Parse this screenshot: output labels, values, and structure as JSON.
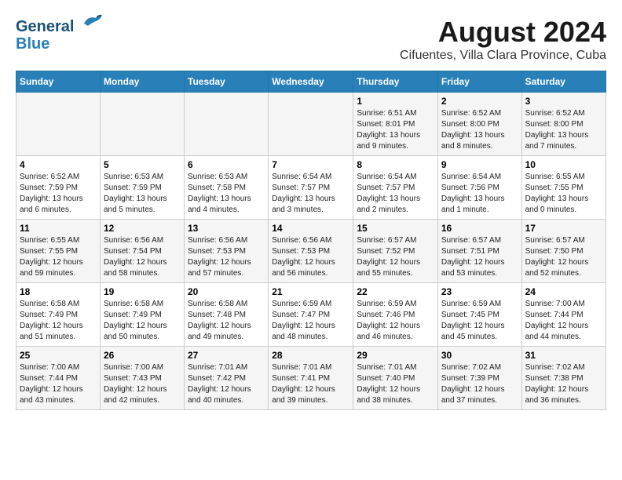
{
  "logo": {
    "line1": "General",
    "line2": "Blue"
  },
  "title": "August 2024",
  "subtitle": "Cifuentes, Villa Clara Province, Cuba",
  "days_of_week": [
    "Sunday",
    "Monday",
    "Tuesday",
    "Wednesday",
    "Thursday",
    "Friday",
    "Saturday"
  ],
  "weeks": [
    [
      {
        "day": "",
        "info": ""
      },
      {
        "day": "",
        "info": ""
      },
      {
        "day": "",
        "info": ""
      },
      {
        "day": "",
        "info": ""
      },
      {
        "day": "1",
        "info": "Sunrise: 6:51 AM\nSunset: 8:01 PM\nDaylight: 13 hours and 9 minutes."
      },
      {
        "day": "2",
        "info": "Sunrise: 6:52 AM\nSunset: 8:00 PM\nDaylight: 13 hours and 8 minutes."
      },
      {
        "day": "3",
        "info": "Sunrise: 6:52 AM\nSunset: 8:00 PM\nDaylight: 13 hours and 7 minutes."
      }
    ],
    [
      {
        "day": "4",
        "info": "Sunrise: 6:52 AM\nSunset: 7:59 PM\nDaylight: 13 hours and 6 minutes."
      },
      {
        "day": "5",
        "info": "Sunrise: 6:53 AM\nSunset: 7:59 PM\nDaylight: 13 hours and 5 minutes."
      },
      {
        "day": "6",
        "info": "Sunrise: 6:53 AM\nSunset: 7:58 PM\nDaylight: 13 hours and 4 minutes."
      },
      {
        "day": "7",
        "info": "Sunrise: 6:54 AM\nSunset: 7:57 PM\nDaylight: 13 hours and 3 minutes."
      },
      {
        "day": "8",
        "info": "Sunrise: 6:54 AM\nSunset: 7:57 PM\nDaylight: 13 hours and 2 minutes."
      },
      {
        "day": "9",
        "info": "Sunrise: 6:54 AM\nSunset: 7:56 PM\nDaylight: 13 hours and 1 minute."
      },
      {
        "day": "10",
        "info": "Sunrise: 6:55 AM\nSunset: 7:55 PM\nDaylight: 13 hours and 0 minutes."
      }
    ],
    [
      {
        "day": "11",
        "info": "Sunrise: 6:55 AM\nSunset: 7:55 PM\nDaylight: 12 hours and 59 minutes."
      },
      {
        "day": "12",
        "info": "Sunrise: 6:56 AM\nSunset: 7:54 PM\nDaylight: 12 hours and 58 minutes."
      },
      {
        "day": "13",
        "info": "Sunrise: 6:56 AM\nSunset: 7:53 PM\nDaylight: 12 hours and 57 minutes."
      },
      {
        "day": "14",
        "info": "Sunrise: 6:56 AM\nSunset: 7:53 PM\nDaylight: 12 hours and 56 minutes."
      },
      {
        "day": "15",
        "info": "Sunrise: 6:57 AM\nSunset: 7:52 PM\nDaylight: 12 hours and 55 minutes."
      },
      {
        "day": "16",
        "info": "Sunrise: 6:57 AM\nSunset: 7:51 PM\nDaylight: 12 hours and 53 minutes."
      },
      {
        "day": "17",
        "info": "Sunrise: 6:57 AM\nSunset: 7:50 PM\nDaylight: 12 hours and 52 minutes."
      }
    ],
    [
      {
        "day": "18",
        "info": "Sunrise: 6:58 AM\nSunset: 7:49 PM\nDaylight: 12 hours and 51 minutes."
      },
      {
        "day": "19",
        "info": "Sunrise: 6:58 AM\nSunset: 7:49 PM\nDaylight: 12 hours and 50 minutes."
      },
      {
        "day": "20",
        "info": "Sunrise: 6:58 AM\nSunset: 7:48 PM\nDaylight: 12 hours and 49 minutes."
      },
      {
        "day": "21",
        "info": "Sunrise: 6:59 AM\nSunset: 7:47 PM\nDaylight: 12 hours and 48 minutes."
      },
      {
        "day": "22",
        "info": "Sunrise: 6:59 AM\nSunset: 7:46 PM\nDaylight: 12 hours and 46 minutes."
      },
      {
        "day": "23",
        "info": "Sunrise: 6:59 AM\nSunset: 7:45 PM\nDaylight: 12 hours and 45 minutes."
      },
      {
        "day": "24",
        "info": "Sunrise: 7:00 AM\nSunset: 7:44 PM\nDaylight: 12 hours and 44 minutes."
      }
    ],
    [
      {
        "day": "25",
        "info": "Sunrise: 7:00 AM\nSunset: 7:44 PM\nDaylight: 12 hours and 43 minutes."
      },
      {
        "day": "26",
        "info": "Sunrise: 7:00 AM\nSunset: 7:43 PM\nDaylight: 12 hours and 42 minutes."
      },
      {
        "day": "27",
        "info": "Sunrise: 7:01 AM\nSunset: 7:42 PM\nDaylight: 12 hours and 40 minutes."
      },
      {
        "day": "28",
        "info": "Sunrise: 7:01 AM\nSunset: 7:41 PM\nDaylight: 12 hours and 39 minutes."
      },
      {
        "day": "29",
        "info": "Sunrise: 7:01 AM\nSunset: 7:40 PM\nDaylight: 12 hours and 38 minutes."
      },
      {
        "day": "30",
        "info": "Sunrise: 7:02 AM\nSunset: 7:39 PM\nDaylight: 12 hours and 37 minutes."
      },
      {
        "day": "31",
        "info": "Sunrise: 7:02 AM\nSunset: 7:38 PM\nDaylight: 12 hours and 36 minutes."
      }
    ]
  ]
}
